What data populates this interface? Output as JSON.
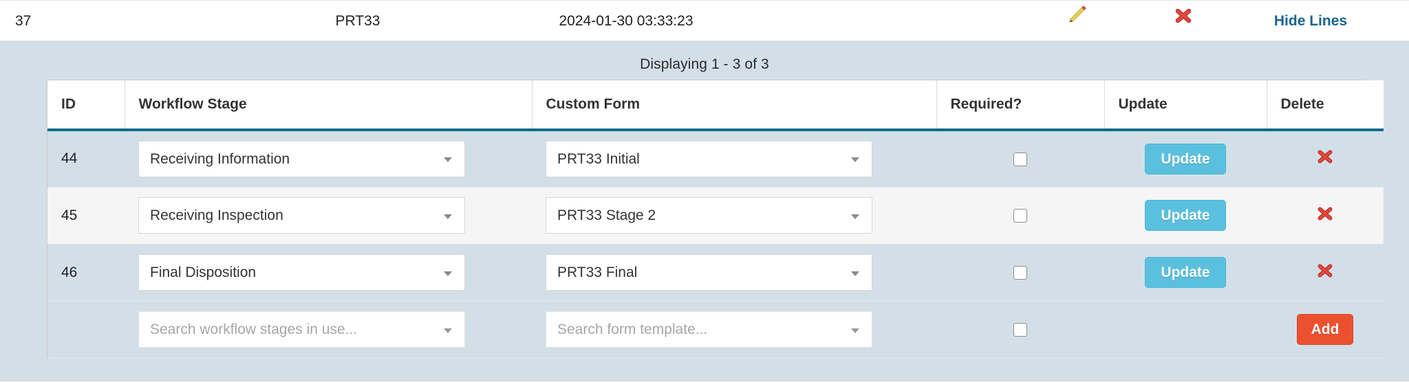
{
  "master_row": {
    "id": "37",
    "name": "PRT33",
    "date": "2024-01-30 03:33:23",
    "edit_icon": "pencil-icon",
    "delete_icon": "red-x-icon",
    "hide_lines_label": "Hide Lines",
    "link_color": "#17648d"
  },
  "detail": {
    "displaying_text": "Displaying 1 - 3 of 3",
    "panel_color": "#d3dfe7",
    "header_underline_color": "#126a8f",
    "columns": [
      "ID",
      "Workflow Stage",
      "Custom Form",
      "Required?",
      "Update",
      "Delete"
    ],
    "rows": [
      {
        "id": "44",
        "workflow_stage": "Receiving Information",
        "custom_form": "PRT33 Initial",
        "required": false,
        "update_label": "Update",
        "delete_icon": "red-x-icon"
      },
      {
        "id": "45",
        "workflow_stage": "Receiving Inspection",
        "custom_form": "PRT33 Stage 2",
        "required": false,
        "update_label": "Update",
        "delete_icon": "red-x-icon"
      },
      {
        "id": "46",
        "workflow_stage": "Final Disposition",
        "custom_form": "PRT33 Final",
        "required": false,
        "update_label": "Update",
        "delete_icon": "red-x-icon"
      }
    ],
    "new_row": {
      "workflow_stage_placeholder": "Search workflow stages in use...",
      "custom_form_placeholder": "Search form template...",
      "required": false,
      "add_label": "Add",
      "add_color": "#ec512f"
    },
    "update_button_color": "#5bc0de"
  }
}
